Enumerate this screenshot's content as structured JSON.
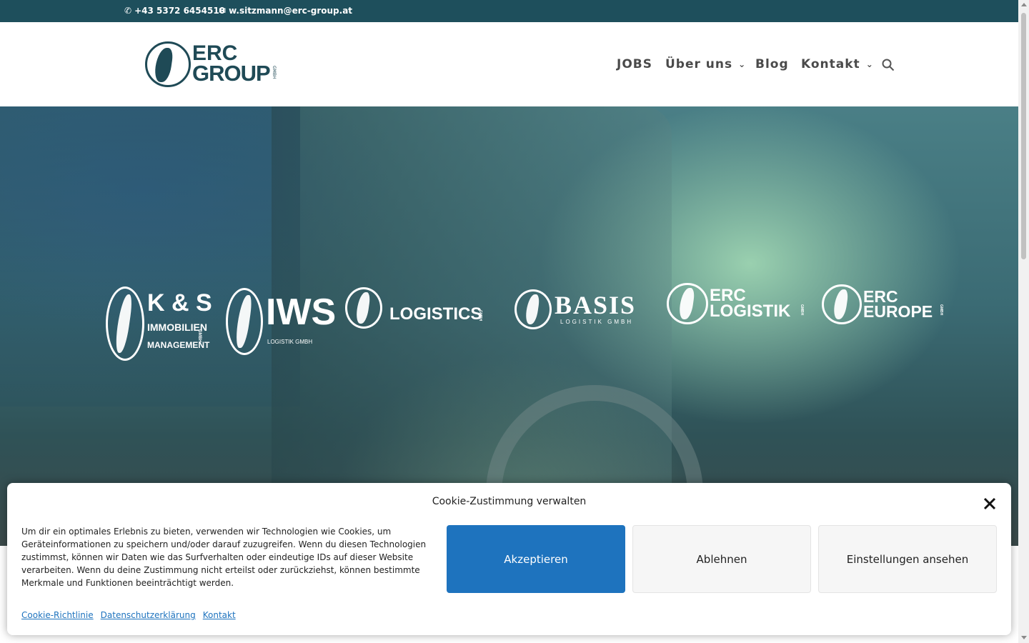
{
  "topbar": {
    "phone": "+43 5372 6454510",
    "email": "w.sitzmann@erc-group.at",
    "phone_icon": "phone-icon",
    "email_icon": "envelope-icon"
  },
  "logo": {
    "line1": "ERC",
    "line2": "GROUP",
    "suffix": "GMBH"
  },
  "nav": {
    "items": [
      {
        "label": "JOBS",
        "has_dropdown": false
      },
      {
        "label": "Über uns",
        "has_dropdown": true
      },
      {
        "label": "Blog",
        "has_dropdown": false
      },
      {
        "label": "Kontakt",
        "has_dropdown": true
      }
    ],
    "search_icon": "search-icon"
  },
  "hero": {
    "brands": [
      {
        "line1": "K & S",
        "line2": "IMMOBILIEN",
        "line3": "MANAGEMENT",
        "suffix": "GMBH"
      },
      {
        "line1": "IWS",
        "line2": "LOGISTIK GMBH"
      },
      {
        "line1": "LOGISTICS",
        "suffix": "GMBH"
      },
      {
        "line1": "BASIS",
        "line2": "LOGISTIK GMBH"
      },
      {
        "line1": "ERC",
        "line2": "LOGISTIK",
        "suffix": "GMBH"
      },
      {
        "line1": "ERC",
        "line2": "EUROPE",
        "suffix": "GMBH"
      }
    ]
  },
  "cookie": {
    "title": "Cookie-Zustimmung verwalten",
    "message": "Um dir ein optimales Erlebnis zu bieten, verwenden wir Technologien wie Cookies, um Geräteinformationen zu speichern und/oder darauf zuzugreifen. Wenn du diesen Technologien zustimmst, können wir Daten wie das Surfverhalten oder eindeutige IDs auf dieser Website verarbeiten. Wenn du deine Zustimmung nicht erteilst oder zurückziehst, können bestimmte Merkmale und Funktionen beeinträchtigt werden.",
    "accept": "Akzeptieren",
    "deny": "Ablehnen",
    "view": "Einstellungen ansehen",
    "links": [
      "Cookie-Richtlinie",
      "Datenschutzerklärung",
      "Kontakt"
    ],
    "accent_color": "#1e73be"
  },
  "colors": {
    "topbar": "#1e4f5c",
    "brand": "#1f4a56"
  }
}
